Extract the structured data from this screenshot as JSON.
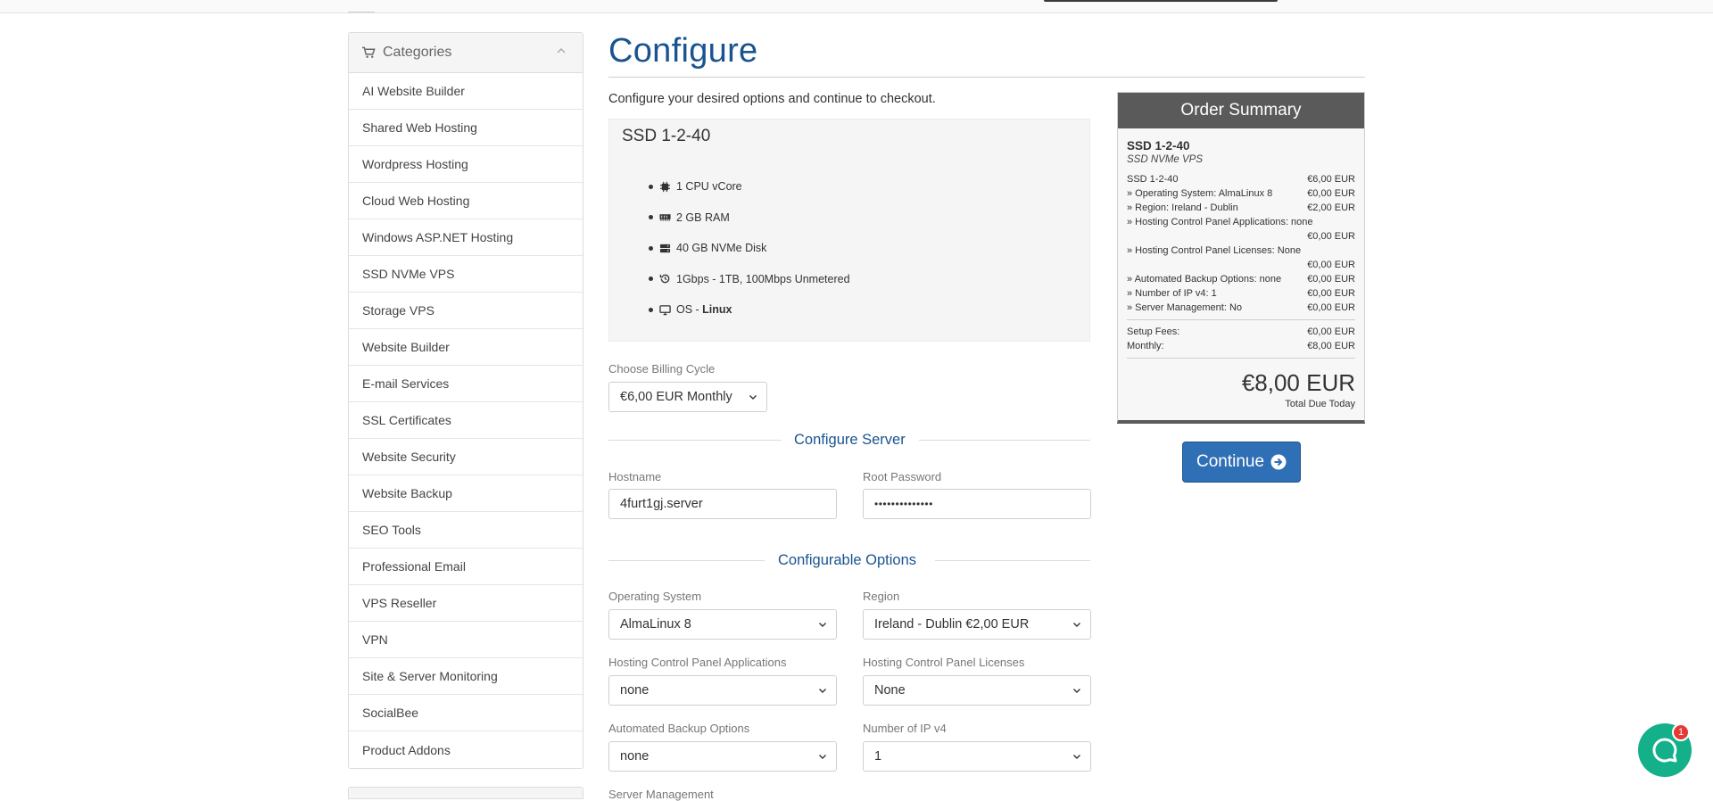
{
  "sidebar": {
    "title": "Categories",
    "items": [
      "AI Website Builder",
      "Shared Web Hosting",
      "Wordpress Hosting",
      "Cloud Web Hosting",
      "Windows ASP.NET Hosting",
      "SSD NVMe VPS",
      "Storage VPS",
      "Website Builder",
      "E-mail Services",
      "SSL Certificates",
      "Website Security",
      "Website Backup",
      "SEO Tools",
      "Professional Email",
      "VPS Reseller",
      "VPN",
      "Site & Server Monitoring",
      "SocialBee",
      "Product Addons"
    ]
  },
  "main": {
    "title": "Configure",
    "intro": "Configure your desired options and continue to checkout.",
    "product": {
      "name": "SSD 1-2-40",
      "features": {
        "cpu": "1 CPU vCore",
        "ram": "2 GB RAM",
        "disk": "40 GB NVMe Disk",
        "bandwidth": "1Gbps - 1TB, 100Mbps Unmetered",
        "os_prefix": "OS - ",
        "os_value": "Linux"
      }
    },
    "billing": {
      "label": "Choose Billing Cycle",
      "value": "€6,00 EUR Monthly"
    },
    "configure_server": {
      "title": "Configure Server",
      "hostname_label": "Hostname",
      "hostname_value": "4furt1gj.server",
      "password_label": "Root Password",
      "password_value": "••••••••••••••"
    },
    "configurable_options": {
      "title": "Configurable Options",
      "os_label": "Operating System",
      "os_value": "AlmaLinux 8",
      "region_label": "Region",
      "region_value": "Ireland - Dublin €2,00 EUR",
      "panel_apps_label": "Hosting Control Panel Applications",
      "panel_apps_value": "none",
      "panel_licenses_label": "Hosting Control Panel Licenses",
      "panel_licenses_value": "None",
      "backup_label": "Automated Backup Options",
      "backup_value": "none",
      "ipv4_label": "Number of IP v4",
      "ipv4_value": "1",
      "server_mgmt_label": "Server Management"
    }
  },
  "summary": {
    "title": "Order Summary",
    "product": "SSD 1-2-40",
    "group": "SSD NVMe VPS",
    "lines": {
      "base_label": "SSD 1-2-40",
      "base_price": "€6,00 EUR",
      "os_label": "» Operating System: AlmaLinux 8",
      "os_price": "€0,00 EUR",
      "region_label": "» Region: Ireland - Dublin",
      "region_price": "€2,00 EUR",
      "apps_label": "» Hosting Control Panel Applications: none",
      "apps_price": "€0,00 EUR",
      "licenses_label": "» Hosting Control Panel Licenses: None",
      "licenses_price": "€0,00 EUR",
      "backup_label": "» Automated Backup Options: none",
      "backup_price": "€0,00 EUR",
      "ipv4_label": "» Number of IP v4: 1",
      "ipv4_price": "€0,00 EUR",
      "mgmt_label": "» Server Management: No",
      "mgmt_price": "€0,00 EUR"
    },
    "setup_label": "Setup Fees:",
    "setup_price": "€0,00 EUR",
    "monthly_label": "Monthly:",
    "monthly_price": "€8,00 EUR",
    "total": "€8,00 EUR",
    "total_label": "Total Due Today"
  },
  "continue_label": "Continue",
  "chat": {
    "badge": "1"
  },
  "colors": {
    "accent": "#1a5490",
    "button": "#2f6fb5",
    "summary_header": "#5a5a5a",
    "chat": "#13b08a",
    "badge": "#e53935"
  }
}
